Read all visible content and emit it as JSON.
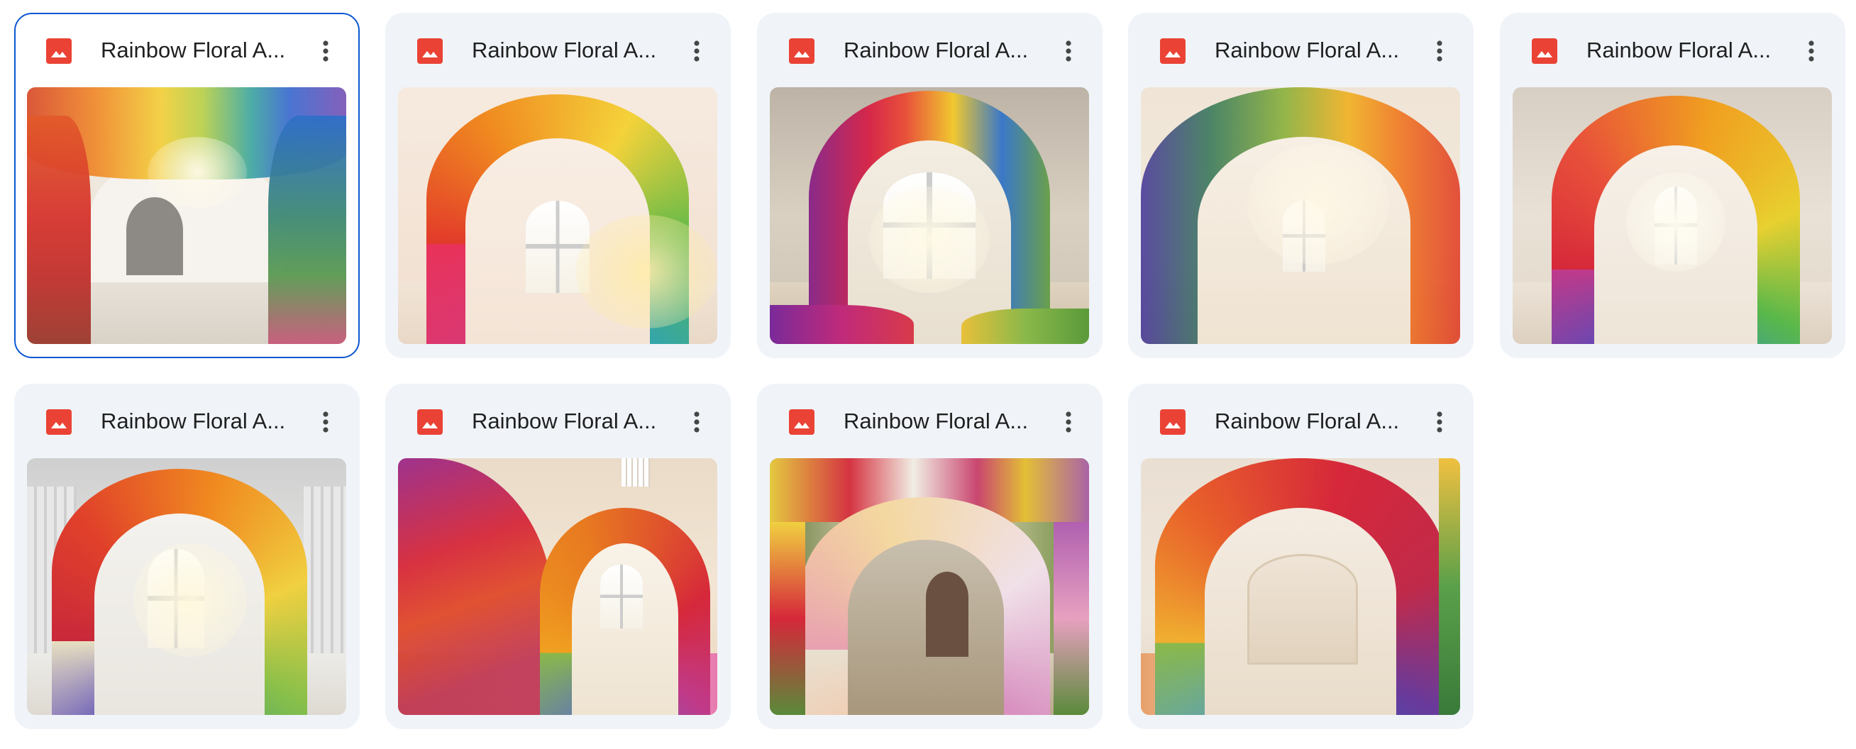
{
  "files": [
    {
      "title": "Rainbow Floral A...",
      "selected": true,
      "file_icon": "image-file-icon",
      "menu_icon": "more-vert-icon"
    },
    {
      "title": "Rainbow Floral A...",
      "selected": false,
      "file_icon": "image-file-icon",
      "menu_icon": "more-vert-icon"
    },
    {
      "title": "Rainbow Floral A...",
      "selected": false,
      "file_icon": "image-file-icon",
      "menu_icon": "more-vert-icon"
    },
    {
      "title": "Rainbow Floral A...",
      "selected": false,
      "file_icon": "image-file-icon",
      "menu_icon": "more-vert-icon"
    },
    {
      "title": "Rainbow Floral A...",
      "selected": false,
      "file_icon": "image-file-icon",
      "menu_icon": "more-vert-icon"
    },
    {
      "title": "Rainbow Floral A...",
      "selected": false,
      "file_icon": "image-file-icon",
      "menu_icon": "more-vert-icon"
    },
    {
      "title": "Rainbow Floral A...",
      "selected": false,
      "file_icon": "image-file-icon",
      "menu_icon": "more-vert-icon"
    },
    {
      "title": "Rainbow Floral A...",
      "selected": false,
      "file_icon": "image-file-icon",
      "menu_icon": "more-vert-icon"
    },
    {
      "title": "Rainbow Floral A...",
      "selected": false,
      "file_icon": "image-file-icon",
      "menu_icon": "more-vert-icon"
    }
  ],
  "colors": {
    "card_background": "#f0f4f9",
    "selected_border": "#0b57d0",
    "image_icon": "#ea4335",
    "title_text": "#1f1f1f",
    "menu_icon": "#444746"
  }
}
